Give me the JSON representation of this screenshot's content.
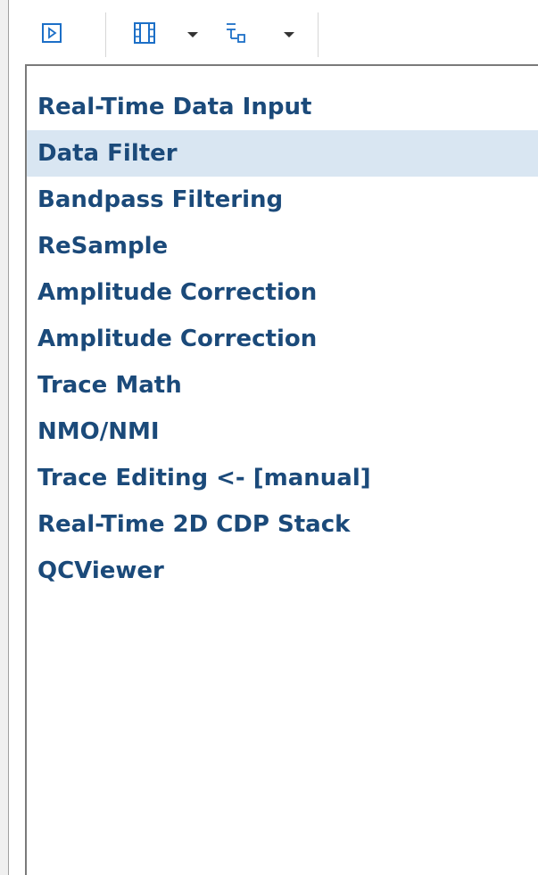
{
  "toolbar": {
    "buttons": [
      {
        "name": "run-icon",
        "has_dropdown": false
      },
      {
        "name": "frames-icon",
        "has_dropdown": true
      },
      {
        "name": "tree-list-icon",
        "has_dropdown": true
      }
    ],
    "accent": "#1c6fc7"
  },
  "flow_list": {
    "selected_index": 1,
    "text_color": "#1b4a7a",
    "selected_bg": "#d9e6f2",
    "items": [
      {
        "label": "Real-Time Data Input"
      },
      {
        "label": "Data Filter"
      },
      {
        "label": "Bandpass Filtering"
      },
      {
        "label": "ReSample"
      },
      {
        "label": "Amplitude Correction"
      },
      {
        "label": "Amplitude Correction"
      },
      {
        "label": "Trace Math"
      },
      {
        "label": "NMO/NMI"
      },
      {
        "label": "Trace Editing <- [manual]"
      },
      {
        "label": "Real-Time 2D CDP Stack"
      },
      {
        "label": "QCViewer"
      }
    ]
  }
}
